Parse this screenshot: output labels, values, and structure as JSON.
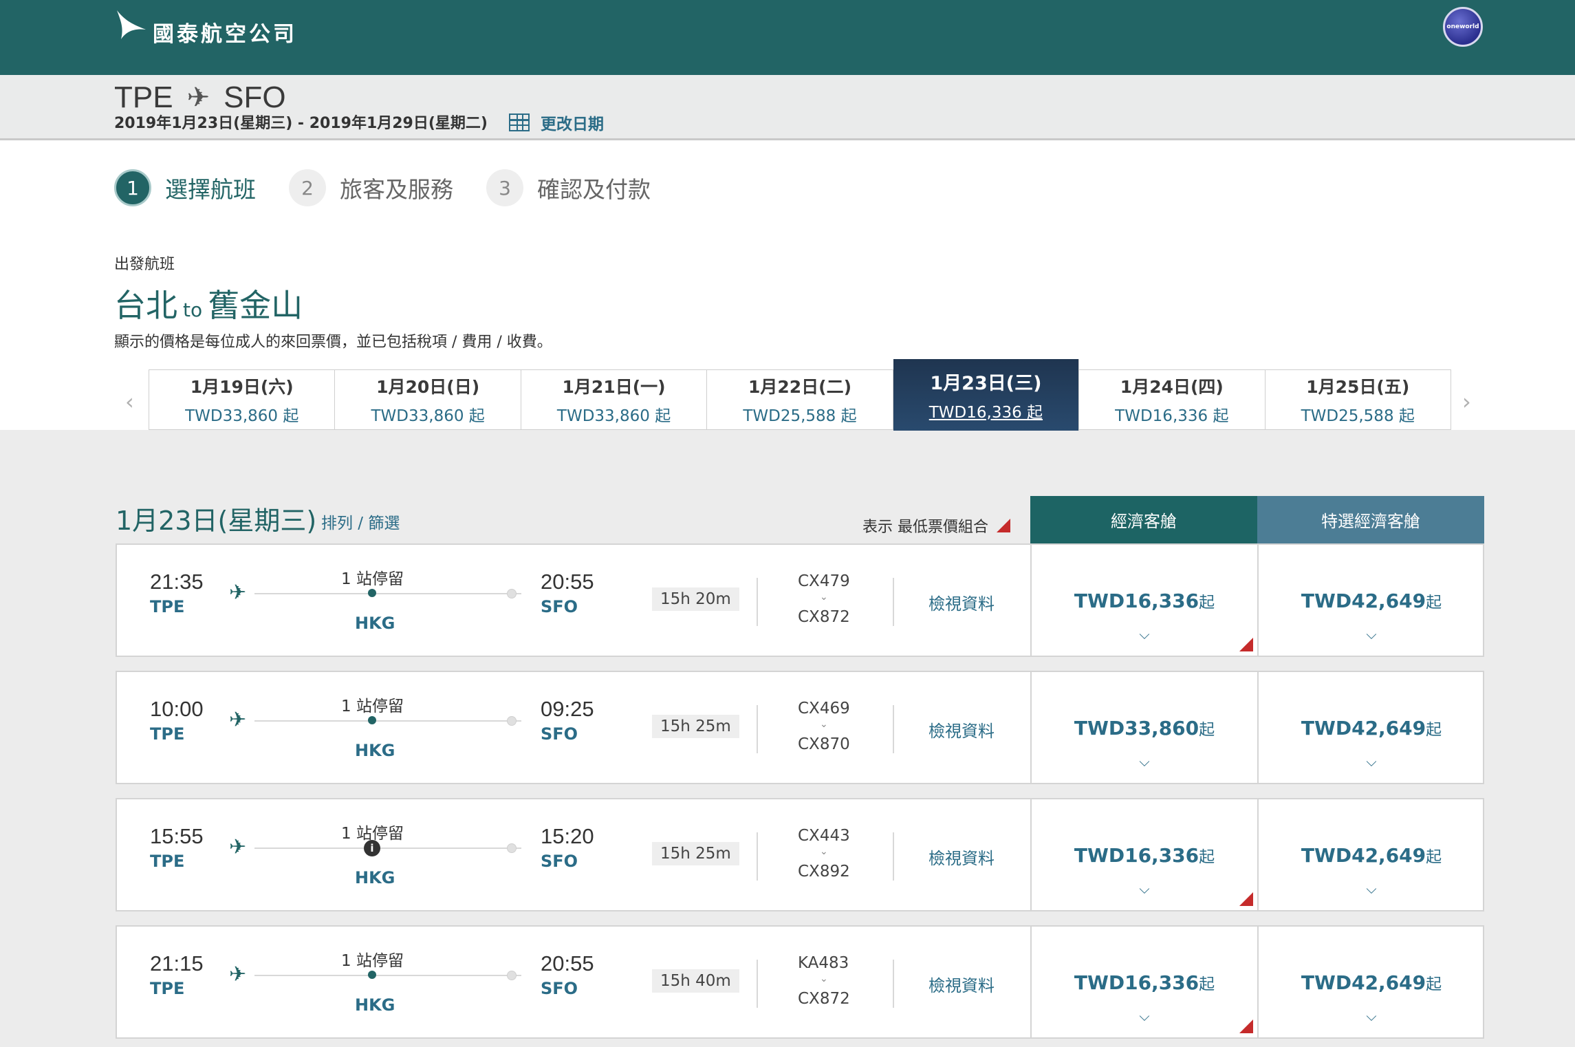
{
  "header": {
    "logo_text": "國泰航空公司",
    "alliance": "oneworld"
  },
  "route": {
    "origin": "TPE",
    "destination": "SFO",
    "dates": "2019年1月23日(星期三) - 2019年1月29日(星期二)",
    "change_date": "更改日期"
  },
  "steps": [
    {
      "num": "1",
      "label": "選擇航班"
    },
    {
      "num": "2",
      "label": "旅客及服務"
    },
    {
      "num": "3",
      "label": "確認及付款"
    }
  ],
  "outbound": {
    "label": "出發航班",
    "from_city": "台北",
    "to_word": "to",
    "to_city": "舊金山",
    "price_note": "顯示的價格是每位成人的來回票價，並已包括稅項 / 費用 / 收費。"
  },
  "date_tabs": [
    {
      "date": "1月19日(六)",
      "price": "TWD33,860 起"
    },
    {
      "date": "1月20日(日)",
      "price": "TWD33,860 起"
    },
    {
      "date": "1月21日(一)",
      "price": "TWD33,860 起"
    },
    {
      "date": "1月22日(二)",
      "price": "TWD25,588 起"
    },
    {
      "date": "1月23日(三)",
      "price": "TWD16,336 起"
    },
    {
      "date": "1月24日(四)",
      "price": "TWD16,336 起"
    },
    {
      "date": "1月25日(五)",
      "price": "TWD25,588 起"
    }
  ],
  "results": {
    "date": "1月23日(星期三)",
    "sort_filter": "排列 / 篩選",
    "legend": "表示 最低票價組合",
    "cabin_economy": "經濟客艙",
    "cabin_premium": "特選經濟客艙",
    "details": "檢視資料",
    "from_suffix": "起"
  },
  "flights": [
    {
      "dep": "21:35",
      "dep_code": "TPE",
      "stop": "1 站停留",
      "via": "HKG",
      "arr": "20:55",
      "arr_code": "SFO",
      "duration": "15h 20m",
      "fno1": "CX479",
      "fno2": "CX872",
      "eco": "TWD16,336",
      "peco": "TWD42,649"
    },
    {
      "dep": "10:00",
      "dep_code": "TPE",
      "stop": "1 站停留",
      "via": "HKG",
      "arr": "09:25",
      "arr_code": "SFO",
      "duration": "15h 25m",
      "fno1": "CX469",
      "fno2": "CX870",
      "eco": "TWD33,860",
      "peco": "TWD42,649"
    },
    {
      "dep": "15:55",
      "dep_code": "TPE",
      "stop": "1 站停留",
      "via": "HKG",
      "arr": "15:20",
      "arr_code": "SFO",
      "duration": "15h 25m",
      "fno1": "CX443",
      "fno2": "CX892",
      "eco": "TWD16,336",
      "peco": "TWD42,649"
    },
    {
      "dep": "21:15",
      "dep_code": "TPE",
      "stop": "1 站停留",
      "via": "HKG",
      "arr": "20:55",
      "arr_code": "SFO",
      "duration": "15h 40m",
      "fno1": "KA483",
      "fno2": "CX872",
      "eco": "TWD16,336",
      "peco": "TWD42,649"
    }
  ],
  "colors": {
    "brand": "#226465",
    "link": "#2b6c87",
    "active_tab": "#1f3550",
    "lowest_fare_marker": "#c52b2b"
  }
}
